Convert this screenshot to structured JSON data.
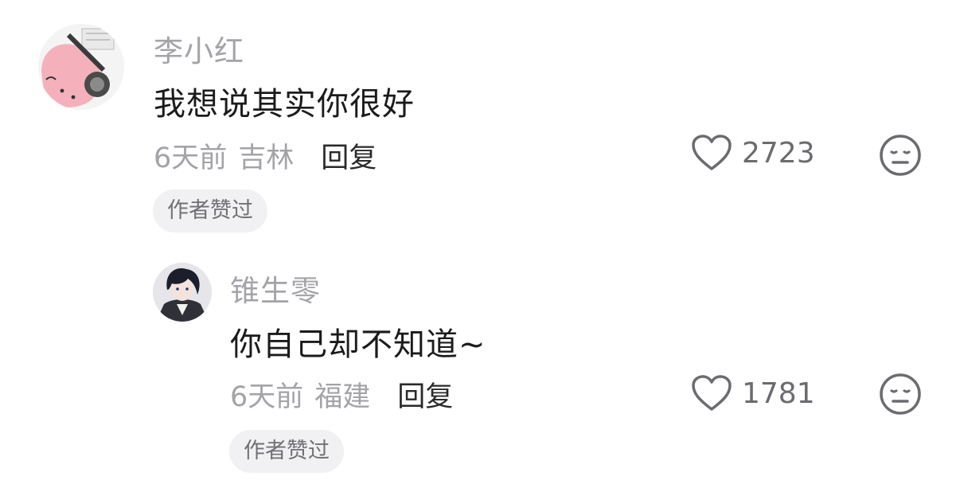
{
  "comments": [
    {
      "username": "李小红",
      "content": "我想说其实你很好",
      "time": "6天前",
      "region": "吉林",
      "reply_label": "回复",
      "likes": "2723",
      "badge": "作者赞过",
      "avatar_icon": "pink-cartoon-avatar-icon"
    },
    {
      "username": "锥生零",
      "content": "你自己却不知道~",
      "time": "6天前",
      "region": "福建",
      "reply_label": "回复",
      "likes": "1781",
      "badge": "作者赞过",
      "avatar_icon": "anime-character-avatar-icon"
    }
  ],
  "icons": {
    "like": "heart-outline-icon",
    "dislike": "unamused-face-icon"
  },
  "colors": {
    "username": "#a3a3a8",
    "content": "#1b1b1b",
    "meta": "#a3a3a8",
    "badge_bg": "#f1f1f3",
    "badge_text": "#707075",
    "icon": "#6b6b70"
  }
}
